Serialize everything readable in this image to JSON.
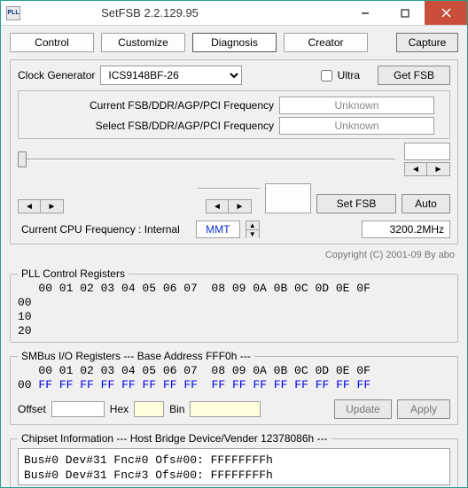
{
  "window": {
    "title": "SetFSB 2.2.129.95",
    "icon_label": "PLL"
  },
  "tabs": {
    "control": "Control",
    "customize": "Customize",
    "diagnosis": "Diagnosis",
    "creator": "Creator"
  },
  "capture_label": "Capture",
  "clockgen": {
    "label": "Clock Generator",
    "value": "ICS9148BF-26",
    "ultra_label": "Ultra",
    "getfsb_label": "Get FSB"
  },
  "freq": {
    "current_label": "Current FSB/DDR/AGP/PCI Frequency",
    "select_label": "Select FSB/DDR/AGP/PCI Frequency",
    "current_value": "Unknown",
    "select_value": "Unknown",
    "setfsb_label": "Set FSB",
    "auto_label": "Auto"
  },
  "cpu": {
    "label": "Current CPU Frequency : Internal",
    "mmt": "MMT",
    "value": "3200.2MHz"
  },
  "copyright": "Copyright (C) 2001-09 By abo",
  "pll": {
    "title": "PLL Control Registers",
    "header": "   00 01 02 03 04 05 06 07  08 09 0A 0B 0C 0D 0E 0F",
    "rows": [
      "00",
      "10",
      "20"
    ]
  },
  "smbus": {
    "title": "SMBus I/O Registers  --- Base Address FFF0h ---",
    "header": "   00 01 02 03 04 05 06 07  08 09 0A 0B 0C 0D 0E 0F",
    "row_prefix": "00 ",
    "vals": [
      "FF",
      "FF",
      "FF",
      "FF",
      "FF",
      "FF",
      "FF",
      "FF",
      "FF",
      "FF",
      "FF",
      "FF",
      "FF",
      "FF",
      "FF",
      "FF"
    ]
  },
  "edit": {
    "offset_label": "Offset",
    "hex_label": "Hex",
    "bin_label": "Bin",
    "update_label": "Update",
    "apply_label": "Apply"
  },
  "chipset": {
    "title": "Chipset Information  --- Host Bridge Device/Vender 12378086h ---",
    "lines": [
      "Bus#0 Dev#31 Fnc#0 Ofs#00: FFFFFFFFh",
      "Bus#0 Dev#31 Fnc#3 Ofs#00: FFFFFFFFh"
    ]
  }
}
